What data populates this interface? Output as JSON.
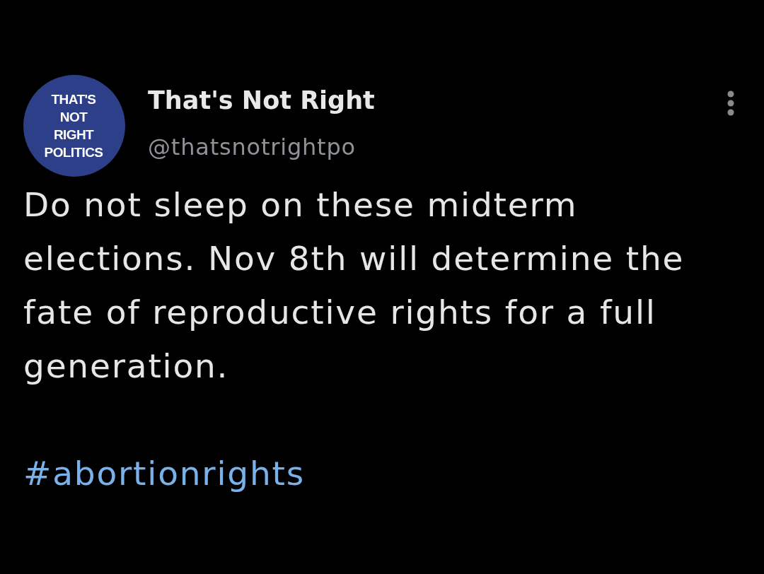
{
  "author": {
    "avatar_text": [
      "THAT'S",
      "NOT",
      "RIGHT",
      "POLITICS"
    ],
    "name": "That's Not Right",
    "handle": "@thatsnotrightpo"
  },
  "tweet": {
    "text": "Do not sleep on these midterm elections. Nov 8th will determine the fate of reproductive rights for a full generation.",
    "hashtags": [
      "#abortionrights"
    ]
  }
}
